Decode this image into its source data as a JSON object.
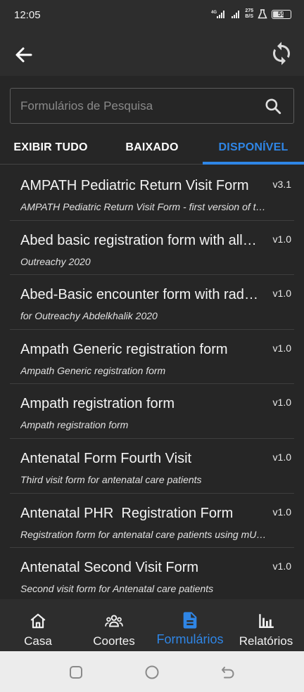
{
  "status_bar": {
    "time": "12:05",
    "network": "4G",
    "speed_value": "275",
    "speed_unit": "B/S",
    "battery": "59",
    "battery_level": 0.59
  },
  "app_bar": {
    "back_icon": "arrow-left-icon",
    "sync_icon": "sync-icon"
  },
  "search": {
    "placeholder": "Formulários de Pesquisa",
    "value": "",
    "icon": "search-icon"
  },
  "tabs": [
    {
      "label": "EXIBIR TUDO",
      "active": false
    },
    {
      "label": "BAIXADO",
      "active": false
    },
    {
      "label": "DISPONÍVEL",
      "active": true
    }
  ],
  "forms": [
    {
      "title": "AMPATH Pediatric Return Visit Form",
      "version": "v3.1",
      "description": "AMPATH Pediatric Return Visit Form - first version of the form"
    },
    {
      "title": "Abed basic registration form with all fields",
      "version": "v1.0",
      "description": "Outreachy 2020"
    },
    {
      "title": "Abed-Basic encounter form with radio buttons",
      "version": "v1.0",
      "description": "for Outreachy Abdelkhalik 2020"
    },
    {
      "title": "Ampath Generic registration form",
      "version": "v1.0",
      "description": "Ampath Generic registration form"
    },
    {
      "title": "Ampath registration form",
      "version": "v1.0",
      "description": "Ampath registration form"
    },
    {
      "title": "Antenatal Form Fourth Visit",
      "version": "v1.0",
      "description": "Third visit form for antenatal care patients"
    },
    {
      "title": "Antenatal PHR  Registration Form",
      "version": "v1.0",
      "description": "Registration form for antenatal care patients using mUzima"
    },
    {
      "title": "Antenatal Second Visit Form",
      "version": "v1.0",
      "description": "Second visit form for Antenatal care patients"
    }
  ],
  "bottom_nav": [
    {
      "label": "Casa",
      "icon": "home-icon",
      "active": false
    },
    {
      "label": "Coortes",
      "icon": "group-icon",
      "active": false
    },
    {
      "label": "Formulários",
      "icon": "document-icon",
      "active": true
    },
    {
      "label": "Relatórios",
      "icon": "bar-chart-icon",
      "active": false
    }
  ],
  "colors": {
    "accent": "#2f86e6",
    "background": "#262626",
    "bar": "#2d2d2d"
  }
}
